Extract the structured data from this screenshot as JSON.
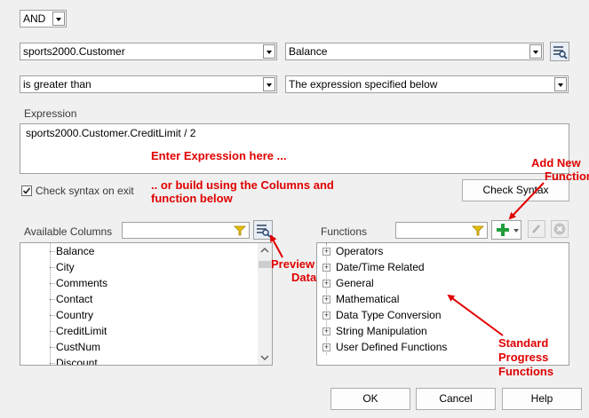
{
  "logic_operator": "AND",
  "table_select": "sports2000.Customer",
  "field_select": "Balance",
  "operator_select": "is greater than",
  "value_source_select": "The expression specified below",
  "expression": {
    "label": "Expression",
    "value": "sports2000.Customer.CreditLimit / 2"
  },
  "check_syntax": {
    "checkbox_label": "Check syntax on exit",
    "checked": true,
    "button_label": "Check Syntax"
  },
  "available_columns": {
    "label": "Available Columns",
    "filter_value": "",
    "items": [
      "Balance",
      "City",
      "Comments",
      "Contact",
      "Country",
      "CreditLimit",
      "CustNum",
      "Discount"
    ]
  },
  "functions": {
    "label": "Functions",
    "filter_value": "",
    "items": [
      "Operators",
      "Date/Time Related",
      "General",
      "Mathematical",
      "Data Type Conversion",
      "String Manipulation",
      "User Defined Functions"
    ]
  },
  "buttons": {
    "ok": "OK",
    "cancel": "Cancel",
    "help": "Help"
  },
  "annotations": {
    "enter_expression": "Enter Expression here ...",
    "build_line1": ".. or build using the Columns and",
    "build_line2": "function below",
    "add_new_line1": "Add New",
    "add_new_line2": "Function",
    "preview_line1": "Preview",
    "preview_line2": "Data",
    "standard_line1": "Standard",
    "standard_line2": "Progress",
    "standard_line3": "Functions"
  },
  "colors": {
    "annotation": "#e00000",
    "add_icon": "#1f9e3a",
    "filter_icon": "#e8c000"
  }
}
